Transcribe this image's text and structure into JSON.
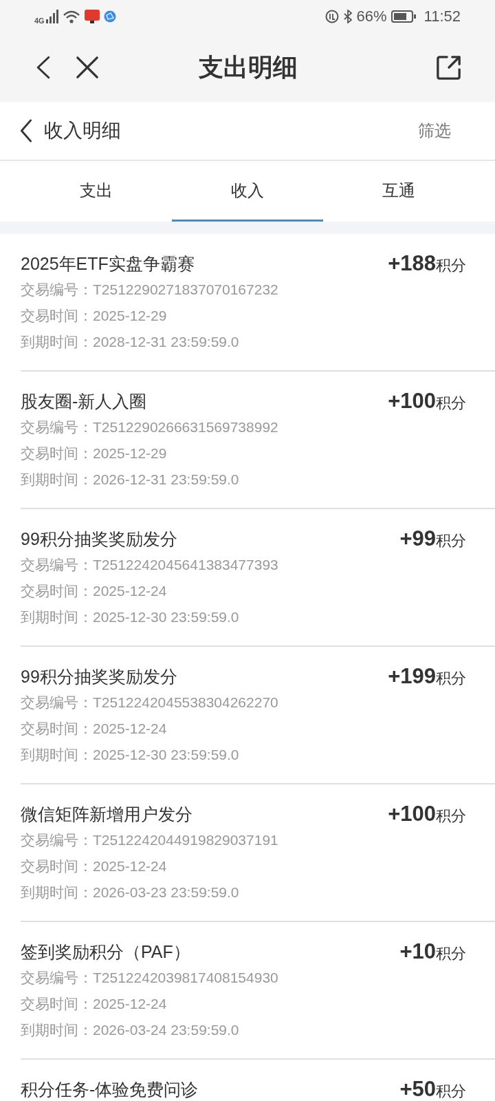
{
  "status_bar": {
    "network": "4G",
    "battery": "66%",
    "time": "11:52"
  },
  "header": {
    "title": "支出明细"
  },
  "subheader": {
    "title": "收入明细",
    "filter": "筛选"
  },
  "tabs": [
    {
      "label": "支出",
      "selected": false
    },
    {
      "label": "收入",
      "selected": true
    },
    {
      "label": "互通",
      "selected": false
    }
  ],
  "records": [
    {
      "title": "2025年ETF实盘争霸赛",
      "points": "+188",
      "unit": "积分",
      "details": [
        {
          "label": "交易编号：",
          "value": "T2512290271837070167232"
        },
        {
          "label": "交易时间：",
          "value": "2025-12-29"
        },
        {
          "label": "到期时间：",
          "value": "2028-12-31 23:59:59.0"
        }
      ]
    },
    {
      "title": "股友圈-新人入圈",
      "points": "+100",
      "unit": "积分",
      "details": [
        {
          "label": "交易编号：",
          "value": "T2512290266631569738992"
        },
        {
          "label": "交易时间：",
          "value": "2025-12-29"
        },
        {
          "label": "到期时间：",
          "value": "2026-12-31 23:59:59.0"
        }
      ]
    },
    {
      "title": "99积分抽奖奖励发分",
      "points": "+99",
      "unit": "积分",
      "details": [
        {
          "label": "交易编号：",
          "value": "T2512242045641383477393"
        },
        {
          "label": "交易时间：",
          "value": "2025-12-24"
        },
        {
          "label": "到期时间：",
          "value": "2025-12-30 23:59:59.0"
        }
      ]
    },
    {
      "title": "99积分抽奖奖励发分",
      "points": "+199",
      "unit": "积分",
      "details": [
        {
          "label": "交易编号：",
          "value": "T2512242045538304262270"
        },
        {
          "label": "交易时间：",
          "value": "2025-12-24"
        },
        {
          "label": "到期时间：",
          "value": "2025-12-30 23:59:59.0"
        }
      ]
    },
    {
      "title": "微信矩阵新增用户发分",
      "points": "+100",
      "unit": "积分",
      "details": [
        {
          "label": "交易编号：",
          "value": "T2512242044919829037191"
        },
        {
          "label": "交易时间：",
          "value": "2025-12-24"
        },
        {
          "label": "到期时间：",
          "value": "2026-03-23 23:59:59.0"
        }
      ]
    },
    {
      "title": "签到奖励积分（PAF）",
      "points": "+10",
      "unit": "积分",
      "details": [
        {
          "label": "交易编号：",
          "value": "T2512242039817408154930"
        },
        {
          "label": "交易时间：",
          "value": "2025-12-24"
        },
        {
          "label": "到期时间：",
          "value": "2026-03-24 23:59:59.0"
        }
      ]
    },
    {
      "title": "积分任务-体验免费问诊",
      "points": "+50",
      "unit": "积分"
    }
  ]
}
